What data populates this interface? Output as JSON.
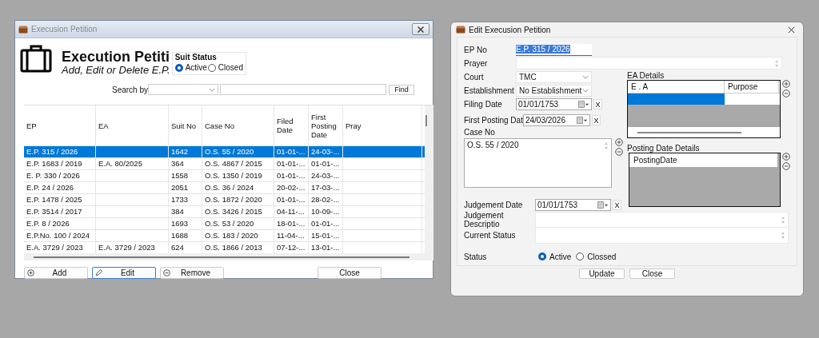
{
  "list_window": {
    "title": "Execusion Petition",
    "heading": "Execution Petiti",
    "subheading": "Add, Edit or Delete E.P.",
    "suit_status": {
      "title": "Suit Status",
      "options": [
        {
          "label": "Active",
          "selected": true
        },
        {
          "label": "Closed",
          "selected": false
        }
      ]
    },
    "search": {
      "label": "Search by",
      "button": "Find"
    },
    "table": {
      "columns": [
        "EP",
        "EA",
        "Suit No",
        "Case No",
        "Filed Date",
        "First Posting Date",
        "Pray"
      ],
      "rows": [
        {
          "selected": true,
          "cells": [
            "E.P. 315 / 2026",
            "",
            "1642",
            "O.S. 55 / 2020",
            "01-01-...",
            "24-03-...",
            ""
          ]
        },
        {
          "selected": false,
          "cells": [
            "E.P. 1683 / 2019",
            "E.A. 80/2025",
            "364",
            "O.S. 4867 / 2015",
            "01-01-...",
            "01-01-...",
            ""
          ]
        },
        {
          "selected": false,
          "cells": [
            "E. P. 330 / 2026",
            "",
            "1558",
            "O.S. 1350 / 2019",
            "01-01-...",
            "24-03-...",
            ""
          ]
        },
        {
          "selected": false,
          "cells": [
            "E.P. 24 / 2026",
            "",
            "2051",
            "O.S.  36 / 2024",
            "20-02-...",
            "17-03-...",
            ""
          ]
        },
        {
          "selected": false,
          "cells": [
            "E.P. 1478 / 2025",
            "",
            "1733",
            "O.S. 1872 / 2020",
            "01-01-...",
            "28-02-...",
            ""
          ]
        },
        {
          "selected": false,
          "cells": [
            "E.P. 3514 / 2017",
            "",
            "384",
            "O.S. 3426 / 2015",
            "04-11-...",
            "10-09-...",
            ""
          ]
        },
        {
          "selected": false,
          "cells": [
            "E.P. 8 / 2026",
            "",
            "1693",
            "O.S. 53 / 2020",
            "18-01-...",
            "01-01-...",
            ""
          ]
        },
        {
          "selected": false,
          "cells": [
            "E.P.No. 100 / 2024",
            "",
            "1688",
            "O.S. 183 / 2020",
            "11-04-...",
            "15-01-...",
            ""
          ]
        },
        {
          "selected": false,
          "cells": [
            " E.A. 3729 / 2023",
            "E.A. 3729 / 2023",
            "624",
            "O.S. 1866 / 2013",
            "07-12-...",
            "13-01-...",
            ""
          ]
        }
      ]
    },
    "buttons": [
      {
        "kind": "add",
        "label": "Add",
        "focused": false
      },
      {
        "kind": "edit",
        "label": "Edit",
        "focused": true
      },
      {
        "kind": "remove",
        "label": "Remove",
        "focused": false
      },
      {
        "kind": "plain",
        "label": "Close",
        "focused": false
      }
    ]
  },
  "edit_window": {
    "title": "Edit Execusion Petition",
    "ep_no": {
      "label": "EP No",
      "value": "E.P. 315 / 2026",
      "text_selected": true
    },
    "prayer": {
      "label": "Prayer"
    },
    "court": {
      "label": "Court",
      "value": "TMC"
    },
    "establishment": {
      "label": "Establishment",
      "value": "No Establishment"
    },
    "filing_date": {
      "label": "Filing Date",
      "value": "01/01/1753",
      "clear": "X"
    },
    "first_posting_date": {
      "label": "First Posting Dat",
      "value": "24/03/2026",
      "clear": "X"
    },
    "case_no": {
      "label": "Case No",
      "value": "O.S. 55 / 2020"
    },
    "ea_details": {
      "title": "EA Details",
      "columns": [
        "E . A",
        "Purpose"
      ],
      "rows": [
        {
          "selected": true
        }
      ]
    },
    "posting_date_details": {
      "title": "Posting Date Details",
      "columns": [
        "PostingDate"
      ]
    },
    "judgement_date": {
      "label": "Judgement Date",
      "value": "01/01/1753",
      "clear": "X"
    },
    "judgement_description": {
      "label": "Judgement Descriptio"
    },
    "current_status": {
      "label": "Current Status"
    },
    "status": {
      "label": "Status",
      "options": [
        {
          "label": "Active",
          "selected": true
        },
        {
          "label": "Clossed",
          "selected": false
        }
      ]
    },
    "buttons": [
      "Update",
      "Close"
    ]
  }
}
